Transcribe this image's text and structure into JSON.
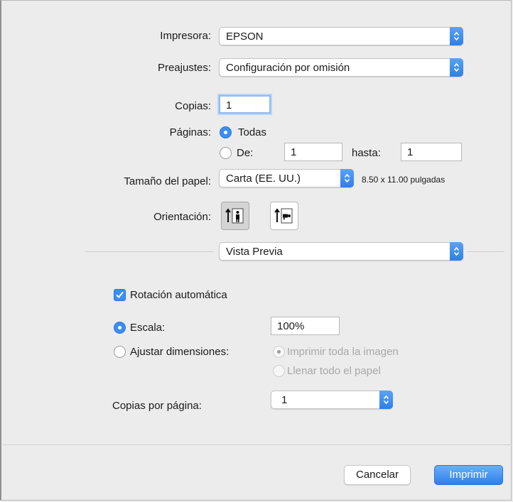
{
  "printer": {
    "label": "Impresora:",
    "value": "EPSON"
  },
  "presets": {
    "label": "Preajustes:",
    "value": "Configuración por omisión"
  },
  "copies": {
    "label": "Copias:",
    "value": "1"
  },
  "pages": {
    "label": "Páginas:",
    "all_label": "Todas",
    "from_label": "De:",
    "from_value": "1",
    "to_label": "hasta:",
    "to_value": "1",
    "selected": "all"
  },
  "paper_size": {
    "label": "Tamaño del papel:",
    "value": "Carta (EE. UU.)",
    "dimensions": "8.50 x 11.00 pulgadas"
  },
  "orientation": {
    "label": "Orientación:",
    "options": [
      "portrait",
      "landscape"
    ],
    "selected": "portrait"
  },
  "section": {
    "value": "Vista Previa"
  },
  "preview": {
    "auto_rotate_label": "Rotación automática",
    "auto_rotate_checked": true,
    "scale_label": "Escala:",
    "scale_value": "100%",
    "fit_label": "Ajustar dimensiones:",
    "fit_option_1": "Imprimir toda la imagen",
    "fit_option_2": "Llenar todo el papel",
    "copies_per_page_label": "Copias por página:",
    "copies_per_page_value": "1"
  },
  "buttons": {
    "cancel": "Cancelar",
    "print": "Imprimir"
  },
  "colors": {
    "accent": "#3b8ef2",
    "background": "#ececec"
  }
}
